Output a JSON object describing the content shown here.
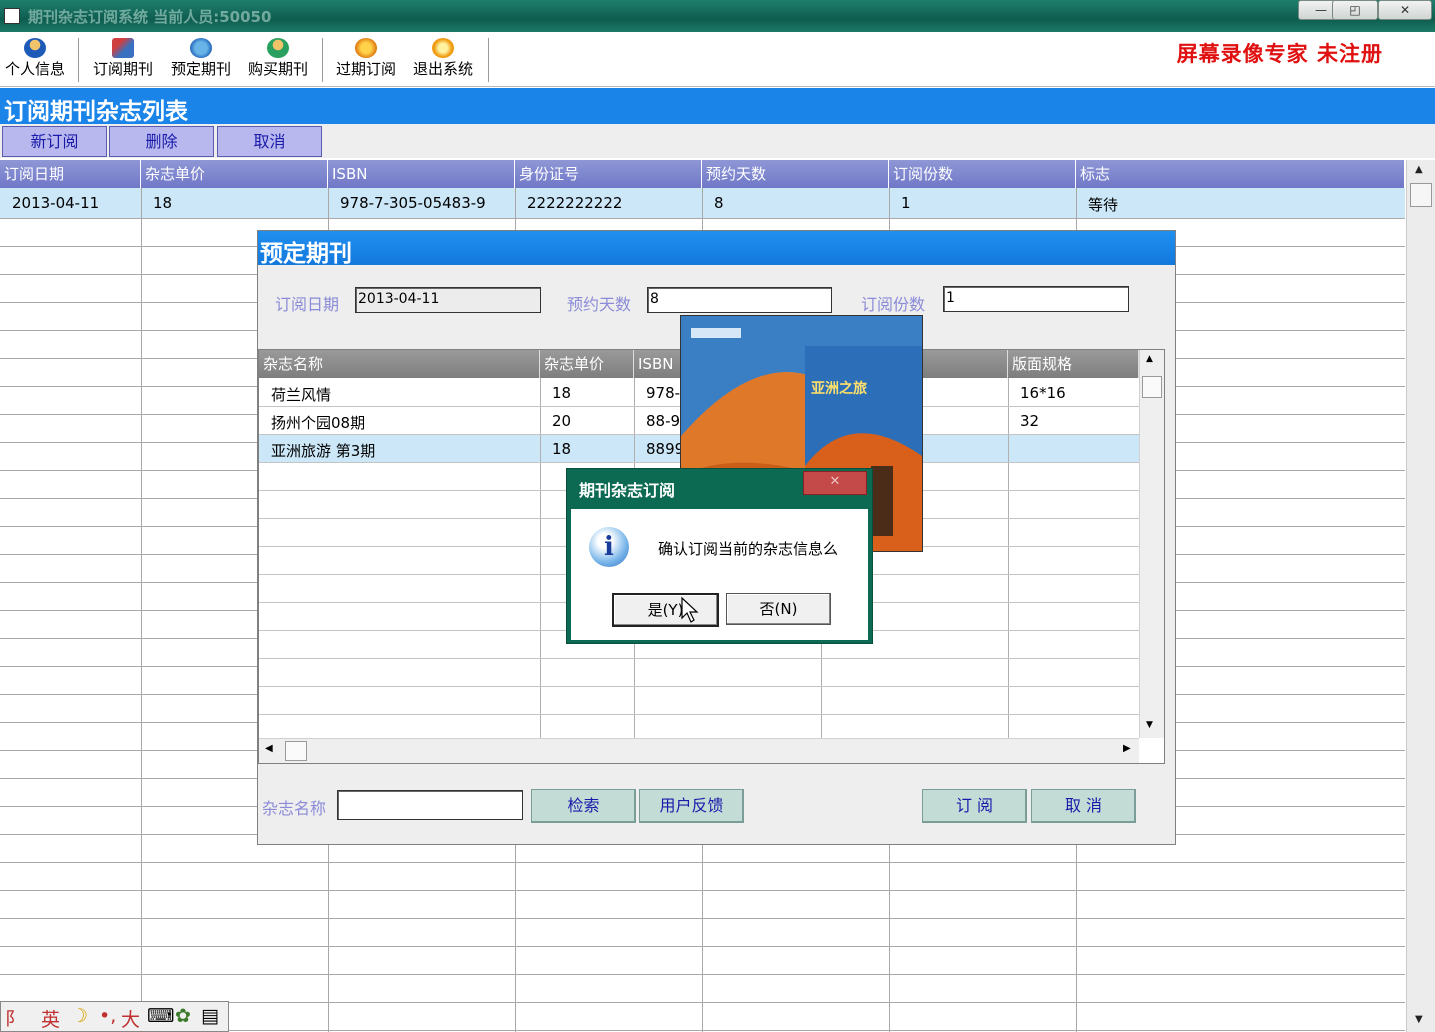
{
  "window": {
    "title": "期刊杂志订阅系统    当前人员:50050",
    "controls": [
      "—",
      "◰",
      "✕"
    ]
  },
  "toolbar": {
    "items": [
      {
        "label": "个人信息",
        "icon": "person-info-icon"
      },
      {
        "label": "订阅期刊",
        "icon": "subscribe-journal-icon"
      },
      {
        "label": "预定期刊",
        "icon": "reserve-journal-icon"
      },
      {
        "label": "购买期刊",
        "icon": "buy-journal-icon"
      },
      {
        "label": "过期订阅",
        "icon": "expired-subscription-icon"
      },
      {
        "label": "退出系统",
        "icon": "exit-system-icon"
      }
    ],
    "watermark": "屏幕录像专家  未注册"
  },
  "list": {
    "heading": "订阅期刊杂志列表",
    "buttons": [
      "新订阅",
      "删除",
      "取消"
    ],
    "columns": [
      "订阅日期",
      "杂志单价",
      "ISBN",
      "身份证号",
      "预约天数",
      "订阅份数",
      "标志"
    ],
    "rows": [
      [
        "2013-04-11",
        "18",
        "978-7-305-05483-9",
        "2222222222",
        "8",
        "1",
        "等待"
      ]
    ]
  },
  "reserve_dialog": {
    "title": "预定期刊",
    "date_label": "订阅日期",
    "date_value": "2013-04-11",
    "days_label": "预约天数",
    "days_value": "8",
    "copies_label": "订阅份数",
    "copies_value": "1",
    "grid_columns": [
      "杂志名称",
      "杂志单价",
      "ISBN",
      "",
      "版面规格"
    ],
    "grid_rows": [
      {
        "name": "荷兰风情",
        "price": "18",
        "isbn": "978-",
        "size": "16*16"
      },
      {
        "name": "扬州个园08期",
        "price": "20",
        "isbn": "88-9",
        "size": "32"
      },
      {
        "name": "亚洲旅游 第3期",
        "price": "18",
        "isbn": "8899",
        "size": ""
      }
    ],
    "search_label": "杂志名称",
    "search_value": "",
    "search_button": "检索",
    "feedback_button": "用户反馈",
    "subscribe_button": "订  阅",
    "cancel_button": "取  消",
    "cover_text": "亚洲之旅"
  },
  "confirm_dialog": {
    "title": "期刊杂志订阅",
    "message": "确认订阅当前的杂志信息么",
    "yes_button": "是(Y)",
    "no_button": "否(N)"
  },
  "ime_bar": {
    "items": [
      "英",
      "大"
    ]
  },
  "colors": {
    "list_header_bg": "#1a84e8",
    "selected_row": "#cce7f8",
    "brand_red": "#e01010",
    "dialog_green": "#0d6a52"
  }
}
